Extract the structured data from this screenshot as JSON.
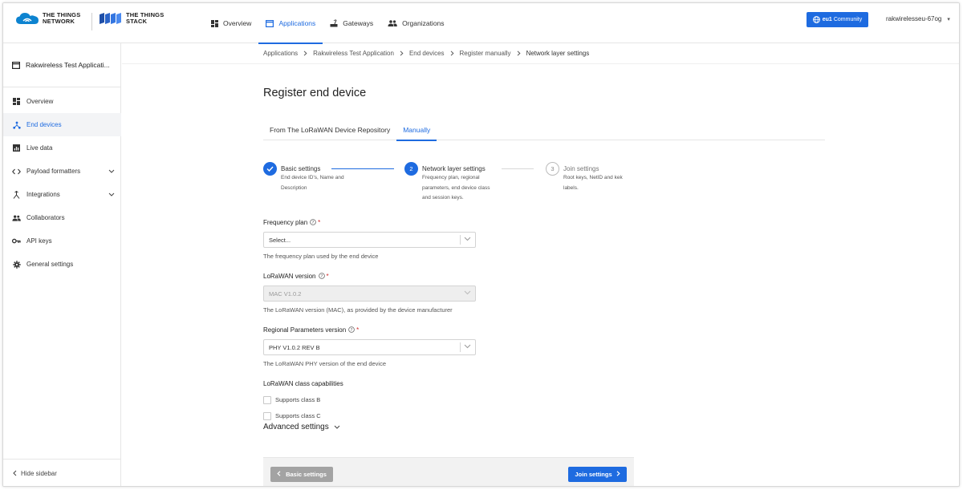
{
  "header": {
    "ttn_logo_text": [
      "THE THINGS",
      "NETWORK"
    ],
    "tts_logo_text": [
      "THE THINGS",
      "STACK"
    ],
    "nav": [
      {
        "label": "Overview",
        "icon": "dashboard-icon",
        "active": false
      },
      {
        "label": "Applications",
        "icon": "application-icon",
        "active": true
      },
      {
        "label": "Gateways",
        "icon": "gateway-icon",
        "active": false
      },
      {
        "label": "Organizations",
        "icon": "organizations-icon",
        "active": false
      }
    ],
    "cluster_label": "eu1",
    "community_label": "Community",
    "username": "rakwirelesseu-67og",
    "accent_color": "#1e6be0"
  },
  "sidebar": {
    "app_title": "Rakwireless Test Applicati...",
    "items": [
      {
        "label": "Overview",
        "icon": "dashboard-icon",
        "active": false
      },
      {
        "label": "End devices",
        "icon": "devices-icon",
        "active": true
      },
      {
        "label": "Live data",
        "icon": "chart-icon",
        "active": false
      },
      {
        "label": "Payload formatters",
        "icon": "code-icon",
        "active": false,
        "expandable": true
      },
      {
        "label": "Integrations",
        "icon": "integration-icon",
        "active": false,
        "expandable": true
      },
      {
        "label": "Collaborators",
        "icon": "people-icon",
        "active": false
      },
      {
        "label": "API keys",
        "icon": "key-icon",
        "active": false
      },
      {
        "label": "General settings",
        "icon": "gear-icon",
        "active": false
      }
    ],
    "hide_label": "Hide sidebar"
  },
  "breadcrumb": [
    "Applications",
    "Rakwireless Test Application",
    "End devices",
    "Register manually",
    "Network layer settings"
  ],
  "page": {
    "title": "Register end device",
    "tabs": [
      {
        "label": "From The LoRaWAN Device Repository",
        "active": false
      },
      {
        "label": "Manually",
        "active": true
      }
    ]
  },
  "steps": [
    {
      "title": "Basic settings",
      "desc": "End device ID's, Name and Description",
      "state": "done",
      "number": ""
    },
    {
      "title": "Network layer settings",
      "desc": "Frequency plan, regional parameters, end device class and session keys.",
      "state": "current",
      "number": "2"
    },
    {
      "title": "Join settings",
      "desc": "Root keys, NetID and kek labels.",
      "state": "todo",
      "number": "3"
    }
  ],
  "form": {
    "frequency_plan": {
      "label": "Frequency plan",
      "value": "",
      "placeholder": "Select...",
      "description": "The frequency plan used by the end device",
      "required": true
    },
    "lorawan_version": {
      "label": "LoRaWAN version",
      "value": "MAC V1.0.2",
      "description": "The LoRaWAN version (MAC), as provided by the device manufacturer",
      "required": true,
      "disabled": true
    },
    "regional_params": {
      "label": "Regional Parameters version",
      "value": "PHY V1.0.2 REV B",
      "description": "The LoRaWAN PHY version of the end device",
      "required": true
    },
    "class_capabilities": {
      "label": "LoRaWAN class capabilities",
      "options": [
        {
          "label": "Supports class B",
          "checked": false
        },
        {
          "label": "Supports class C",
          "checked": false
        }
      ]
    },
    "advanced_label": "Advanced settings"
  },
  "footer": {
    "back_label": "Basic settings",
    "next_label": "Join settings"
  }
}
